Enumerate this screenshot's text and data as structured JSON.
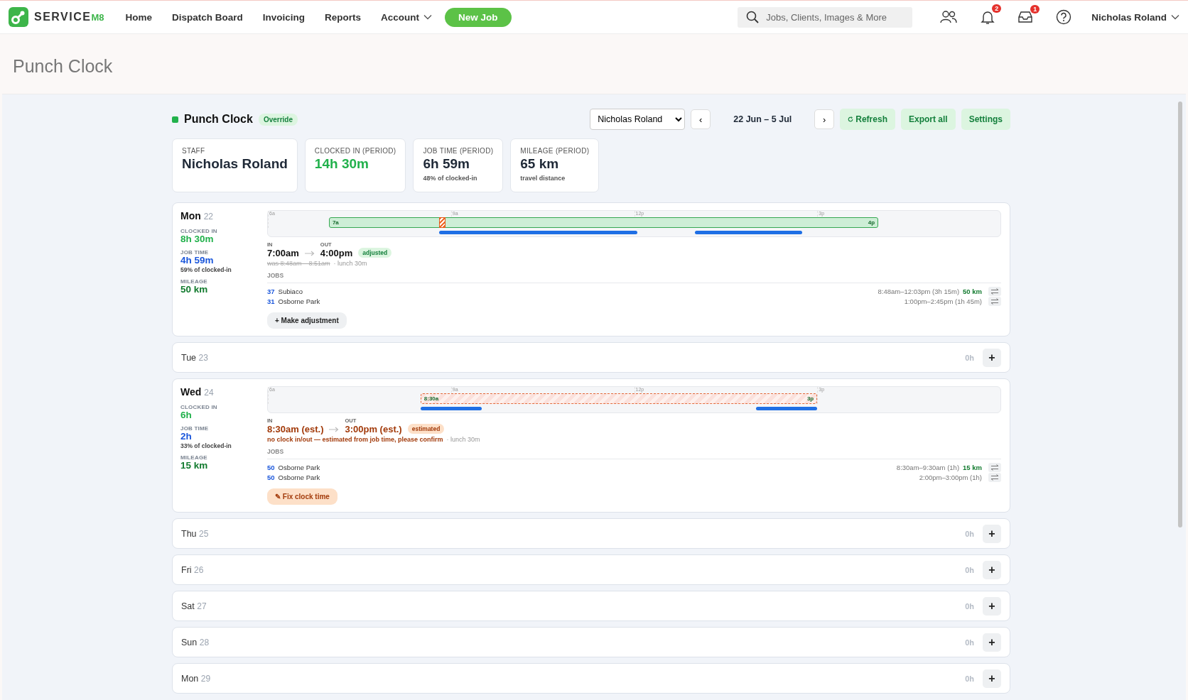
{
  "nav": {
    "logo": {
      "text": "SERVICE",
      "accent": "M8"
    },
    "items": [
      {
        "label": "Home",
        "dropdown": false
      },
      {
        "label": "Dispatch Board",
        "dropdown": false
      },
      {
        "label": "Invoicing",
        "dropdown": false
      },
      {
        "label": "Reports",
        "dropdown": false
      },
      {
        "label": "Account",
        "dropdown": true
      }
    ],
    "new_job": "New Job",
    "search": {
      "placeholder": "Jobs, Clients, Images & More"
    },
    "notifications": "2",
    "inbox": "1",
    "user": "Nicholas Roland"
  },
  "page_title": "Punch Clock",
  "panel": {
    "title": "Punch Clock",
    "badge": "Override",
    "staff_select": "Nicholas Roland",
    "prev": "‹",
    "range": "22 Jun – 5 Jul",
    "next": "›",
    "buttons": [
      {
        "label": "Refresh",
        "kind": "refresh"
      },
      {
        "label": "Export all",
        "kind": "plain"
      },
      {
        "label": "Settings",
        "kind": "plain"
      }
    ]
  },
  "stats": [
    {
      "label": "STAFF",
      "value": "Nicholas Roland",
      "color": "#1f2937"
    },
    {
      "label": "CLOCKED IN (PERIOD)",
      "value": "14h 30m",
      "color": "#22b14c"
    },
    {
      "label": "JOB TIME (PERIOD)",
      "value": "6h 59m",
      "sub": "48% of clocked-in",
      "color": "#1f2937"
    },
    {
      "label": "MILEAGE (PERIOD)",
      "value": "65 km",
      "sub": "travel distance",
      "color": "#1f2937"
    }
  ],
  "days": [
    {
      "kind": "detail",
      "name": "Mon",
      "date": "22",
      "clocked_label": "CLOCKED IN",
      "clocked": "8h 30m",
      "job_label": "JOB TIME",
      "job": "4h 59m",
      "job_sub": "59% of clocked-in",
      "mileage_label": "MILEAGE",
      "mileage": "50 km",
      "ticks": [
        "6a",
        "9a",
        "12p",
        "3p"
      ],
      "block_start": "7a",
      "block_end": "4p",
      "in_label": "IN",
      "in": "7:00am",
      "out_label": "OUT",
      "out": "4:00pm",
      "status": {
        "kind": "adjusted",
        "label": "adjusted"
      },
      "was": "was 8:48am – 8:51am",
      "lunch": " · lunch 30m",
      "jobs_label": "JOBS",
      "jobs": [
        {
          "number": "37",
          "name": "Subiaco",
          "time": "8:48am–12:03pm (3h 15m)",
          "km": "50 km"
        },
        {
          "number": "31",
          "name": "Osborne Park",
          "time": "1:00pm–2:45pm (1h 45m)"
        }
      ],
      "action": "+ Make adjustment"
    },
    {
      "kind": "empty",
      "name": "Tue",
      "date": "23",
      "total": "0h",
      "add": "+"
    },
    {
      "kind": "detail",
      "name": "Wed",
      "date": "24",
      "clocked_label": "CLOCKED IN",
      "clocked": "6h",
      "job_label": "JOB TIME",
      "job": "2h",
      "job_sub": "33% of clocked-in",
      "mileage_label": "MILEAGE",
      "mileage": "15 km",
      "ticks": [
        "6a",
        "9a",
        "12p",
        "3p"
      ],
      "block_start": "8:30a",
      "block_end": "3p",
      "in_label": "IN",
      "in": "8:30am (est.)",
      "out_label": "OUT",
      "out": "3:00pm (est.)",
      "status": {
        "kind": "estimated",
        "label": "estimated"
      },
      "note": "no clock in/out — estimated from job time, please confirm",
      "lunch": " · lunch 30m",
      "jobs_label": "JOBS",
      "jobs": [
        {
          "number": "50",
          "name": "Osborne Park",
          "time": "8:30am–9:30am (1h)",
          "km": "15 km"
        },
        {
          "number": "50",
          "name": "Osborne Park",
          "time": "2:00pm–3:00pm (1h)"
        }
      ],
      "action": "✎ Fix clock time"
    },
    {
      "kind": "empty",
      "name": "Thu",
      "date": "25",
      "total": "0h",
      "add": "+"
    },
    {
      "kind": "empty",
      "name": "Fri",
      "date": "26",
      "total": "0h",
      "add": "+"
    },
    {
      "kind": "empty",
      "name": "Sat",
      "date": "27",
      "total": "0h",
      "add": "+"
    },
    {
      "kind": "empty",
      "name": "Sun",
      "date": "28",
      "total": "0h",
      "add": "+"
    },
    {
      "kind": "empty",
      "name": "Mon",
      "date": "29",
      "total": "0h",
      "add": "+"
    }
  ]
}
